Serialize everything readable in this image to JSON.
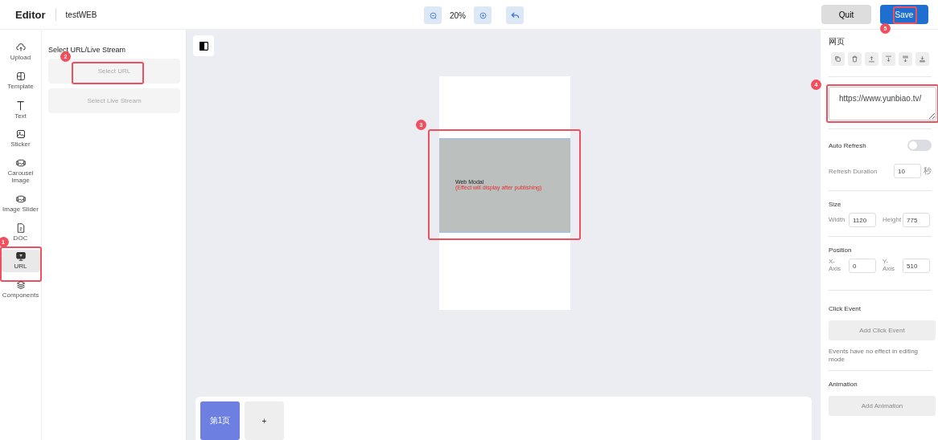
{
  "header": {
    "title": "Editor",
    "project": "testWEB",
    "zoom": "20%",
    "quit": "Quit",
    "save": {
      "label": "Save",
      "callout": "5"
    }
  },
  "rail": [
    {
      "label": "Upload",
      "selected": false
    },
    {
      "label": "Template",
      "selected": false
    },
    {
      "label": "Text",
      "selected": false
    },
    {
      "label": "Sticker",
      "selected": false
    },
    {
      "label": "Carousel Image",
      "selected": false
    },
    {
      "label": "Image Slider",
      "selected": false
    },
    {
      "label": "DOC",
      "selected": false
    },
    {
      "label": "URL",
      "selected": true,
      "callout": "1"
    },
    {
      "label": "Components",
      "selected": false
    }
  ],
  "panel": {
    "title": "Select URL/Live Stream",
    "options": [
      {
        "label": "Select URL",
        "callout": "2"
      },
      {
        "label": "Select Live Stream"
      }
    ]
  },
  "canvas": {
    "module": {
      "title": "Web Modal",
      "note": "(Effect will display after publishing)",
      "callout": "3"
    },
    "pages": [
      {
        "label": "第1页",
        "selected": true
      }
    ],
    "add_page": "+"
  },
  "props": {
    "heading": "网页",
    "url": {
      "value": "https://www.yunbiao.tv/",
      "callout": "4"
    },
    "auto_refresh": {
      "label": "Auto Refresh",
      "on": false
    },
    "refresh": {
      "label": "Refresh Duration",
      "value": "10",
      "unit": "秒"
    },
    "size": {
      "title": "Size",
      "fields": [
        {
          "label": "Width",
          "value": "1120"
        },
        {
          "label": "Height",
          "value": "775"
        }
      ]
    },
    "position": {
      "title": "Position",
      "fields": [
        {
          "label": "X-Axis",
          "value": "0"
        },
        {
          "label": "Y-Axis",
          "value": "510"
        }
      ]
    },
    "click_event": {
      "title": "Click Event",
      "button": "Add Click Event",
      "note": "Events have no effect in editing mode"
    },
    "animation": {
      "title": "Animation",
      "button": "Add Animation"
    }
  }
}
